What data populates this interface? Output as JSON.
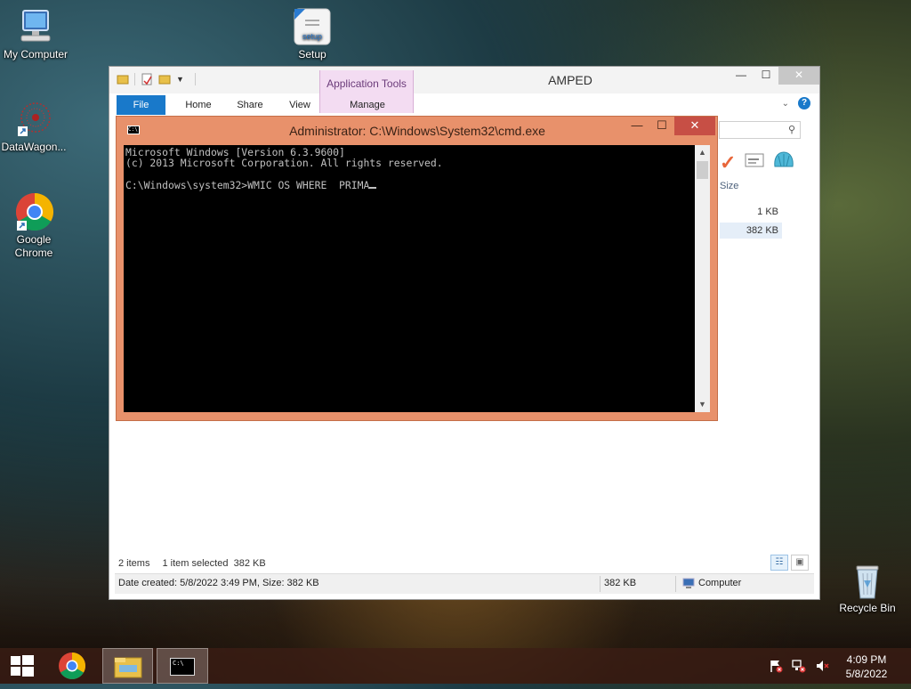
{
  "desktop": {
    "icons": [
      {
        "label": "My Computer",
        "icon": "computer-icon"
      },
      {
        "label": "Setup",
        "icon": "setup-icon"
      },
      {
        "label": "DataWagon...",
        "icon": "datawagon-icon"
      },
      {
        "label": "Google Chrome",
        "icon": "chrome-icon"
      },
      {
        "label": "Recycle Bin",
        "icon": "recycle-bin-icon"
      }
    ]
  },
  "explorer": {
    "title": "AMPED",
    "context_tab": "Application Tools",
    "tabs": [
      "File",
      "Home",
      "Share",
      "View",
      "Manage"
    ],
    "column_size": "Size",
    "sizes": [
      "1 KB",
      "382 KB"
    ],
    "status": {
      "items_count": "2 items",
      "selected": "1 item selected",
      "selected_size": "382 KB",
      "details": "Date created: 5/8/2022 3:49 PM, Size: 382 KB",
      "size": "382 KB",
      "location": "Computer"
    }
  },
  "cmd": {
    "title": "Administrator: C:\\Windows\\System32\\cmd.exe",
    "lines": [
      "Microsoft Windows [Version 6.3.9600]",
      "(c) 2013 Microsoft Corporation. All rights reserved.",
      "",
      "C:\\Windows\\system32>WMIC OS WHERE  PRIMA"
    ]
  },
  "taskbar": {
    "time": "4:09 PM",
    "date": "5/8/2022",
    "cmd_icon_text": "C:\\"
  },
  "colors": {
    "accent_blue": "#1979ca",
    "cmd_frame": "#e8916b",
    "cmd_close": "#c74f45",
    "context_tab": "#f3dcf2"
  }
}
